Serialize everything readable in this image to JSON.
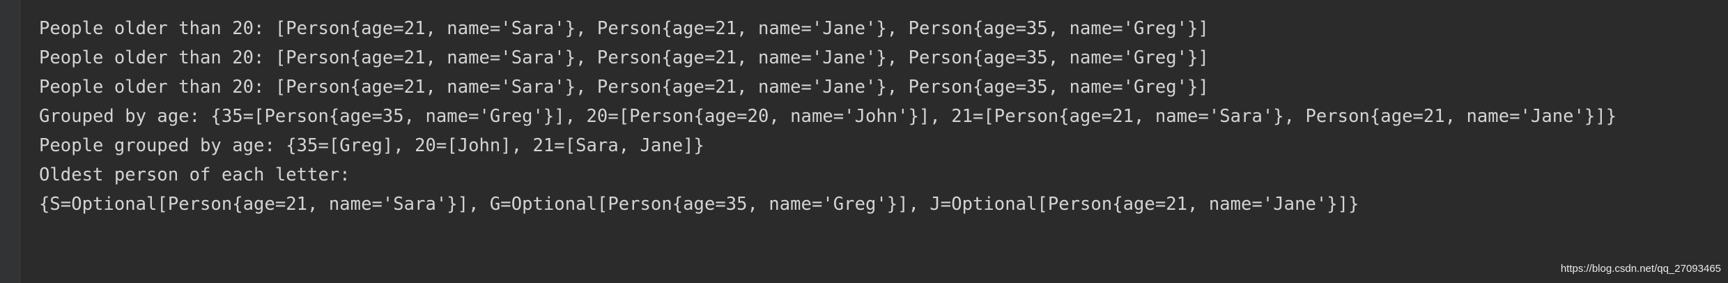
{
  "console": {
    "lines": [
      "People older than 20: [Person{age=21, name='Sara'}, Person{age=21, name='Jane'}, Person{age=35, name='Greg'}]",
      "People older than 20: [Person{age=21, name='Sara'}, Person{age=21, name='Jane'}, Person{age=35, name='Greg'}]",
      "People older than 20: [Person{age=21, name='Sara'}, Person{age=21, name='Jane'}, Person{age=35, name='Greg'}]",
      "Grouped by age: {35=[Person{age=35, name='Greg'}], 20=[Person{age=20, name='John'}], 21=[Person{age=21, name='Sara'}, Person{age=21, name='Jane'}]}",
      "People grouped by age: {35=[Greg], 20=[John], 21=[Sara, Jane]}",
      "Oldest person of each letter:",
      "{S=Optional[Person{age=21, name='Sara'}], G=Optional[Person{age=35, name='Greg'}], J=Optional[Person{age=21, name='Jane'}]}"
    ]
  },
  "watermark": {
    "text": "https://blog.csdn.net/qq_27093465"
  },
  "colors": {
    "background": "#2b2b2b",
    "gutter": "#313335",
    "text": "#d4d4d4"
  }
}
